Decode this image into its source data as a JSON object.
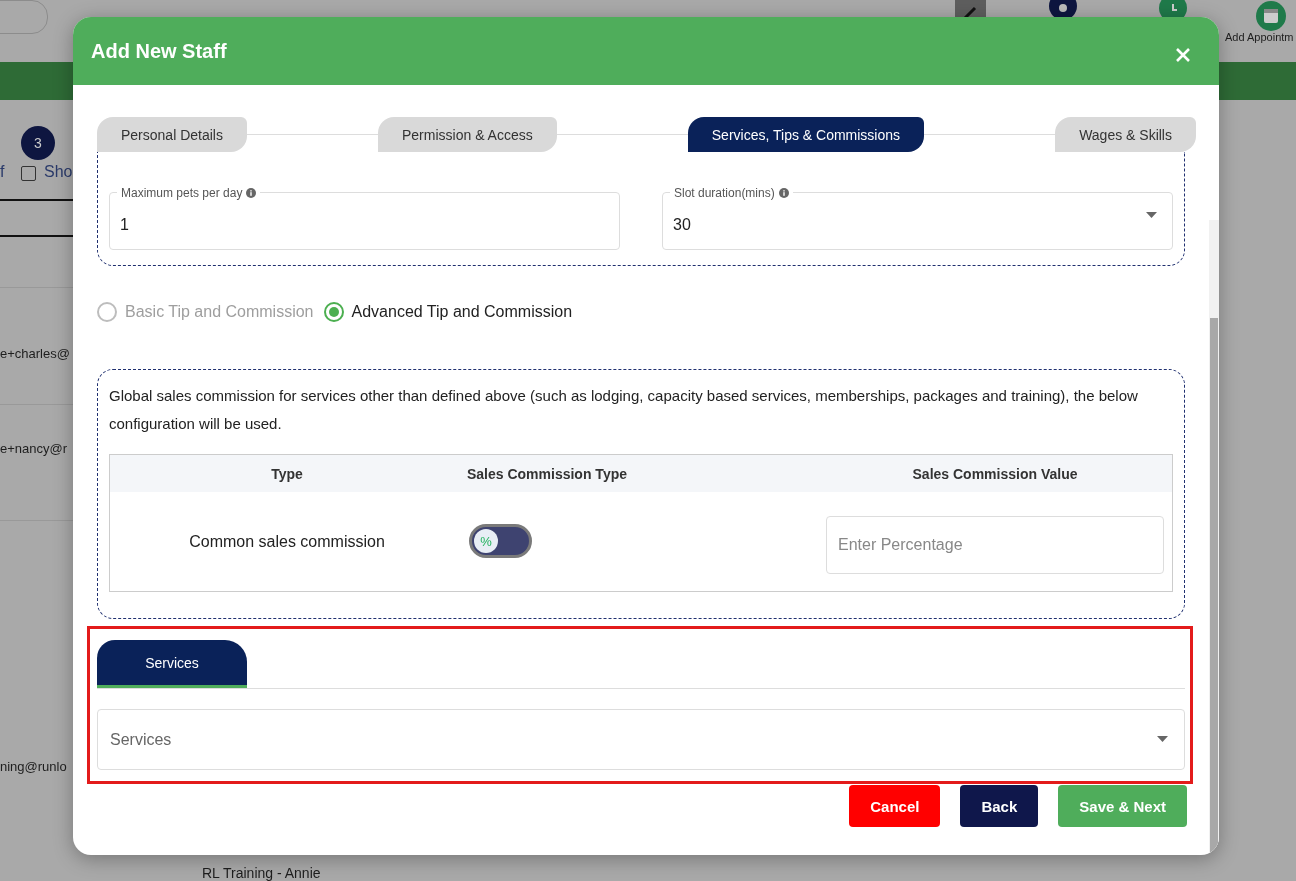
{
  "page_behind": {
    "toolbar_action": "Add Appointm",
    "count_badge": "3",
    "filter_label": "f",
    "checkbox": {
      "label": "Sho",
      "checked": false
    },
    "emails": [
      "e+charles@",
      "e+nancy@r",
      "ning@runlo"
    ],
    "trainer": "RL Training - Annie"
  },
  "dialog": {
    "title": "Add New Staff",
    "steps": [
      {
        "label": "Personal Details",
        "selected": false
      },
      {
        "label": "Permission & Access",
        "selected": false
      },
      {
        "label": "Services, Tips & Commissions",
        "selected": true
      },
      {
        "label": "Wages & Skills",
        "selected": false
      }
    ],
    "fields": [
      {
        "label": "Maximum pets per day",
        "value": "1",
        "kind": "text"
      },
      {
        "label": "Slot duration(mins)",
        "value": "30",
        "kind": "select"
      }
    ],
    "tip_modes": [
      {
        "label": "Basic Tip and Commission",
        "selected": false,
        "disabled": true
      },
      {
        "label": "Advanced Tip and Commission",
        "selected": true,
        "disabled": false
      }
    ],
    "commission_note": "Global sales commission for services other than defined above (such as lodging, capacity based services, memberships, packages and training), the below configuration will be used.",
    "commission_table": {
      "columns": [
        "Type",
        "Sales Commission Type",
        "Sales Commission Value"
      ],
      "rows": [
        {
          "type": "Common sales commission",
          "toggle_symbol": "%",
          "on": false,
          "placeholder": "Enter Percentage"
        }
      ]
    },
    "service_tabs": [
      {
        "label": "Services",
        "selected": true
      }
    ],
    "services_select": {
      "placeholder": "Services"
    },
    "buttons": [
      {
        "label": "Cancel",
        "kind": "danger"
      },
      {
        "label": "Back",
        "kind": "secondary"
      },
      {
        "label": "Save & Next",
        "kind": "primary"
      }
    ]
  }
}
